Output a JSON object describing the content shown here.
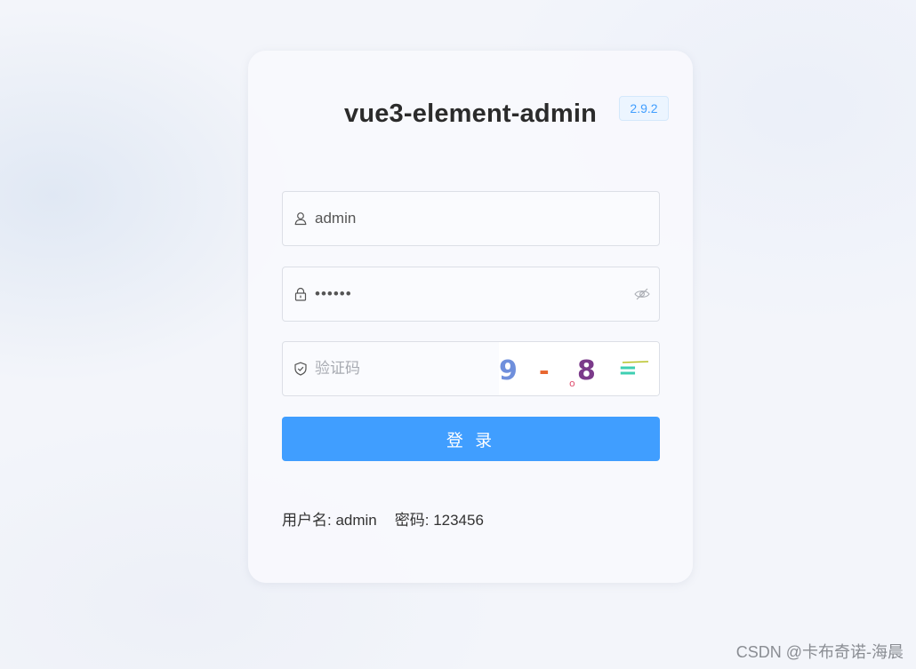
{
  "login": {
    "title": "vue3-element-admin",
    "version": "2.9.2",
    "username": {
      "icon": "user-icon",
      "value": "admin"
    },
    "password": {
      "icon": "lock-icon",
      "value": "123456",
      "toggle_icon": "eye-slash-icon"
    },
    "captcha": {
      "icon": "shield-check-icon",
      "placeholder": "验证码",
      "image_text": "9-8=",
      "colors": [
        "#6f8fdc",
        "#e8662f",
        "#7b3a8a",
        "#3ecfb2"
      ]
    },
    "submit_label": "登 录",
    "hint": {
      "username": "用户名: admin",
      "password": "密码: 123456"
    }
  },
  "watermark": "CSDN @卡布奇诺-海晨",
  "colors": {
    "primary": "#409eff",
    "border": "#dcdfe6",
    "tag_bg": "#ecf5ff"
  }
}
